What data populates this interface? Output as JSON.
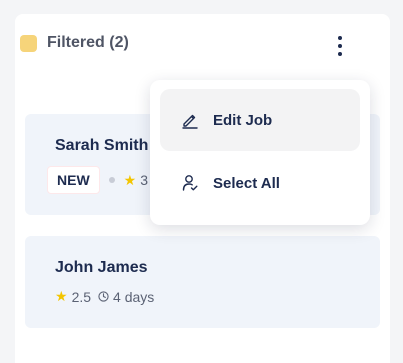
{
  "header": {
    "label": "Filtered (2)",
    "swatch_color": "#f6d47a"
  },
  "cards": [
    {
      "name": "Sarah Smith",
      "badge": "NEW",
      "rating": "3"
    },
    {
      "name": "John James",
      "rating": "2.5",
      "duration": "4 days"
    }
  ],
  "menu": {
    "items": [
      {
        "label": "Edit Job",
        "icon": "pencil-icon"
      },
      {
        "label": "Select All",
        "icon": "user-check-icon"
      }
    ]
  },
  "icons": {
    "star": "★",
    "kebab": "more-vertical-icon",
    "clock": "clock-icon"
  }
}
